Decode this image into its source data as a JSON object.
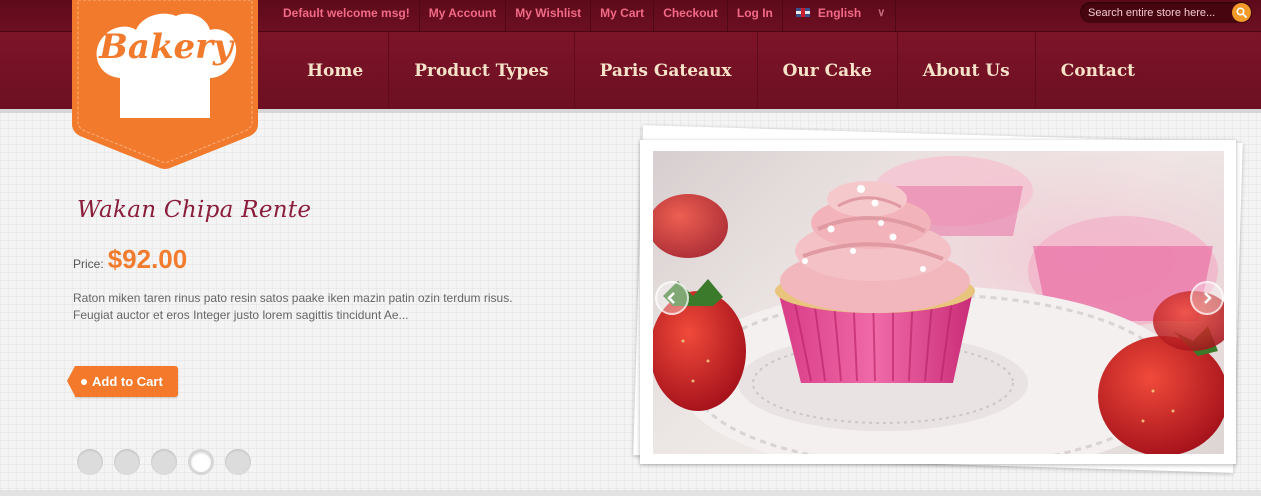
{
  "top_links": [
    "Default welcome msg!",
    "My Account",
    "My Wishlist",
    "My Cart",
    "Checkout",
    "Log In"
  ],
  "language": {
    "label": "English"
  },
  "search": {
    "placeholder": "Search entire store here..."
  },
  "logo": {
    "text": "Bakery"
  },
  "nav": [
    "Home",
    "Product Types",
    "Paris Gateaux",
    "Our Cake",
    "About Us",
    "Contact"
  ],
  "product": {
    "title": "Wakan Chipa Rente",
    "price_label": "Price:",
    "price": "$92.00",
    "description": "Raton miken taren rinus pato resin satos paake iken mazin patin ozin terdum risus. Feugiat auctor et eros Integer justo lorem sagittis tincidunt Ae...",
    "add_to_cart": "Add to Cart"
  },
  "slider": {
    "slide_count": 5,
    "active_index": 4
  },
  "colors": {
    "brand": "#6d0f22",
    "accent": "#f5792a",
    "link": "#f26a85"
  }
}
